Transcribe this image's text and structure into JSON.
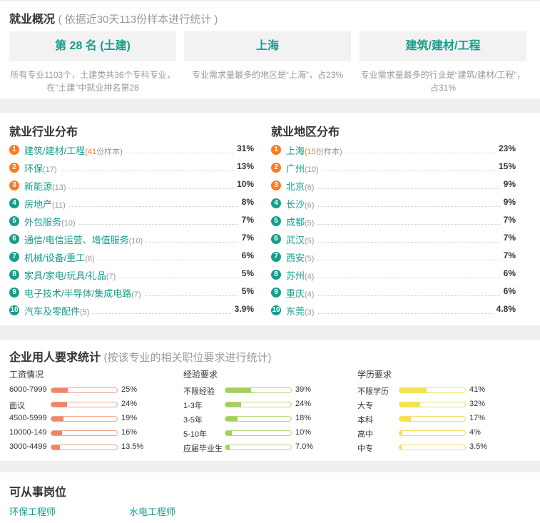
{
  "overview": {
    "title": "就业概况",
    "subtitle": "( 依据近30天113份样本进行统计 )",
    "boxes": [
      {
        "value": "第 28 名 (土建)",
        "desc": "所有专业1103个，土建类共36个专科专业，在“土建”中就业排名第28"
      },
      {
        "value": "上海",
        "desc": "专业需求量最多的地区是“上海”，占23%"
      },
      {
        "value": "建筑/建材/工程",
        "desc": "专业需求量最多的行业是“建筑/建材/工程”，占31%"
      }
    ]
  },
  "industry": {
    "title": "就业行业分布",
    "unit": "份样本",
    "items": [
      {
        "rank": "1",
        "name": "建筑/建材/工程",
        "count": "41",
        "pct": "31%"
      },
      {
        "rank": "2",
        "name": "环保",
        "count": "(17)",
        "pct": "13%"
      },
      {
        "rank": "3",
        "name": "新能源",
        "count": "(13)",
        "pct": "10%"
      },
      {
        "rank": "4",
        "name": "房地产",
        "count": "(11)",
        "pct": "8%"
      },
      {
        "rank": "5",
        "name": "外包服务",
        "count": "(10)",
        "pct": "7%"
      },
      {
        "rank": "6",
        "name": "通信/电信运营、增值服务",
        "count": "(10)",
        "pct": "7%"
      },
      {
        "rank": "7",
        "name": "机械/设备/重工",
        "count": "(8)",
        "pct": "6%"
      },
      {
        "rank": "8",
        "name": "家具/家电/玩具/礼品",
        "count": "(7)",
        "pct": "5%"
      },
      {
        "rank": "9",
        "name": "电子技术/半导体/集成电路",
        "count": "(7)",
        "pct": "5%"
      },
      {
        "rank": "10",
        "name": "汽车及零配件",
        "count": "(5)",
        "pct": "3.9%"
      }
    ]
  },
  "region": {
    "title": "就业地区分布",
    "unit": "份样本",
    "items": [
      {
        "rank": "1",
        "name": "上海",
        "count": "15",
        "pct": "23%"
      },
      {
        "rank": "2",
        "name": "广州",
        "count": "(10)",
        "pct": "15%"
      },
      {
        "rank": "3",
        "name": "北京",
        "count": "(6)",
        "pct": "9%"
      },
      {
        "rank": "4",
        "name": "长沙",
        "count": "(6)",
        "pct": "9%"
      },
      {
        "rank": "5",
        "name": "成都",
        "count": "(5)",
        "pct": "7%"
      },
      {
        "rank": "6",
        "name": "武汉",
        "count": "(5)",
        "pct": "7%"
      },
      {
        "rank": "7",
        "name": "西安",
        "count": "(5)",
        "pct": "7%"
      },
      {
        "rank": "8",
        "name": "苏州",
        "count": "(4)",
        "pct": "6%"
      },
      {
        "rank": "9",
        "name": "重庆",
        "count": "(4)",
        "pct": "6%"
      },
      {
        "rank": "10",
        "name": "东莞",
        "count": "(3)",
        "pct": "4.8%"
      }
    ]
  },
  "requirements": {
    "title": "企业用人要求统计",
    "subtitle": "(按该专业的相关职位要求进行统计)",
    "salary": {
      "head": "工资情况",
      "color": "#f08466",
      "rows": [
        {
          "label": "6000-7999",
          "value": "25%",
          "fraction": 0.25
        },
        {
          "label": "面议",
          "value": "24%",
          "fraction": 0.24
        },
        {
          "label": "4500-5999",
          "value": "19%",
          "fraction": 0.19
        },
        {
          "label": "10000-149",
          "value": "16%",
          "fraction": 0.16
        },
        {
          "label": "3000-4499",
          "value": "13.5%",
          "fraction": 0.135
        }
      ]
    },
    "experience": {
      "head": "经验要求",
      "color": "#a3cf5c",
      "rows": [
        {
          "label": "不限经验",
          "value": "39%",
          "fraction": 0.39
        },
        {
          "label": "1-3年",
          "value": "24%",
          "fraction": 0.24
        },
        {
          "label": "3-5年",
          "value": "18%",
          "fraction": 0.18
        },
        {
          "label": "5-10年",
          "value": "10%",
          "fraction": 0.1
        },
        {
          "label": "应届毕业生",
          "value": "7.0%",
          "fraction": 0.07
        }
      ]
    },
    "education": {
      "head": "学历要求",
      "color": "#f3e44a",
      "rows": [
        {
          "label": "不限学历",
          "value": "41%",
          "fraction": 0.41
        },
        {
          "label": "大专",
          "value": "32%",
          "fraction": 0.32
        },
        {
          "label": "本科",
          "value": "17%",
          "fraction": 0.17
        },
        {
          "label": "高中",
          "value": "4%",
          "fraction": 0.04
        },
        {
          "label": "中专",
          "value": "3.5%",
          "fraction": 0.035
        }
      ]
    }
  },
  "jobs": {
    "title": "可从事岗位",
    "items": [
      "环保工程师",
      "水电工程师"
    ]
  }
}
